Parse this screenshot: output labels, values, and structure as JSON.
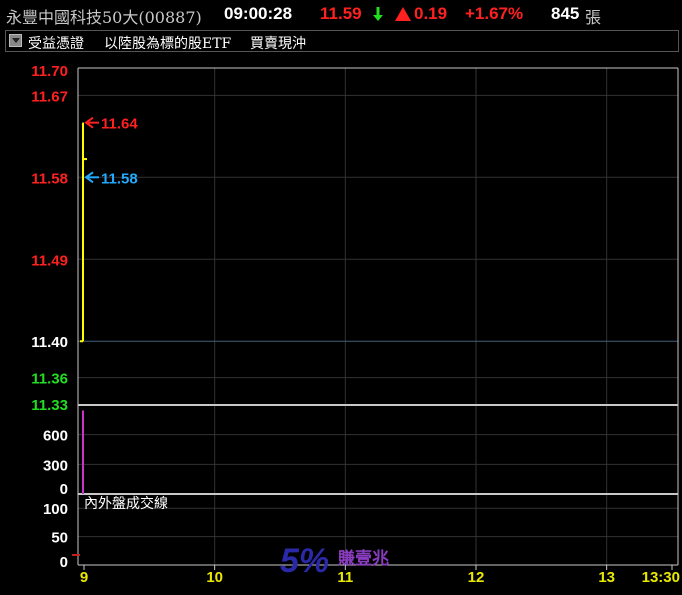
{
  "header": {
    "stock_name": "永豐中國科技50大(00887)",
    "time": "09:00:28",
    "price": "11.59",
    "change": "0.19",
    "change_pct": "+1.67%",
    "volume": "845",
    "volume_unit": "張"
  },
  "subheader": {
    "category": "受益憑證",
    "description": "以陸股為標的股ETF",
    "daytrade": "買賣現沖"
  },
  "chart_data": [
    {
      "type": "line",
      "panel": "price",
      "yticks": [
        {
          "label": "11.70",
          "value": 11.7,
          "color": "#ff2020"
        },
        {
          "label": "11.67",
          "value": 11.67,
          "color": "#ff2020"
        },
        {
          "label": "11.58",
          "value": 11.58,
          "color": "#ff2020"
        },
        {
          "label": "11.49",
          "value": 11.49,
          "color": "#ff2020"
        },
        {
          "label": "11.40",
          "value": 11.4,
          "color": "#ffffff"
        },
        {
          "label": "11.36",
          "value": 11.36,
          "color": "#22dd22"
        },
        {
          "label": "11.33",
          "value": 11.33,
          "color": "#22dd22"
        }
      ],
      "ylim": [
        11.33,
        11.7
      ],
      "reference_price": 11.4,
      "high_marker": {
        "label": "11.64",
        "value": 11.64,
        "color": "#ff2020"
      },
      "low_marker": {
        "label": "11.58",
        "value": 11.58,
        "color": "#22aaff"
      },
      "series": [
        {
          "time": [
            "09:00",
            "09:00"
          ],
          "values": [
            11.4,
            11.64
          ],
          "color": "#ffff00"
        }
      ],
      "tick_value": 11.59
    },
    {
      "type": "bar",
      "panel": "volume",
      "yticks": [
        {
          "label": "600",
          "value": 600
        },
        {
          "label": "300",
          "value": 300
        },
        {
          "label": "0",
          "value": 0
        }
      ],
      "ylim": [
        0,
        900
      ],
      "values": [
        845
      ],
      "color": "#cc33cc"
    },
    {
      "type": "line",
      "panel": "inner_outer",
      "title": "內外盤成交線",
      "yticks": [
        {
          "label": "100",
          "value": 100
        },
        {
          "label": "50",
          "value": 50
        },
        {
          "label": "0",
          "value": 0
        }
      ]
    }
  ],
  "xaxis": {
    "labels": [
      "9",
      "10",
      "11",
      "12",
      "13",
      "13:30"
    ]
  },
  "watermark": {
    "big": "5%",
    "small": "賺壹兆"
  },
  "colors": {
    "up": "#ff2020",
    "down": "#22dd22",
    "price_line": "#ffff00",
    "grid": "#333333",
    "axis": "#c8c8c8"
  }
}
